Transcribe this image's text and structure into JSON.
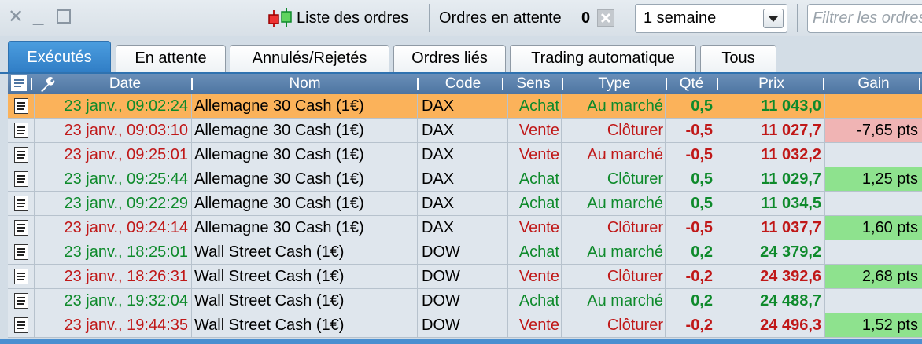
{
  "toolbar": {
    "close_icon": "close-icon",
    "minimize_icon": "minimize-icon",
    "maximize_icon": "maximize-icon",
    "title": "Liste des ordres",
    "pending_label": "Ordres en attente",
    "pending_count": "0",
    "period": "1 semaine",
    "filter_placeholder": "Filtrer les ordres"
  },
  "tabs": [
    "Exécutés",
    "En attente",
    "Annulés/Rejetés",
    "Ordres liés",
    "Trading automatique",
    "Tous"
  ],
  "columns": [
    "Date",
    "Nom",
    "Code",
    "Sens",
    "Type",
    "Qté",
    "Prix",
    "Gain"
  ],
  "colors": {
    "buy": "#0e8a2b",
    "sell": "#c01818",
    "selected": "#fbb25a",
    "gain_positive": "#8ee28e",
    "gain_negative": "#f0b4b4",
    "tab_active": "#3b8bd4"
  },
  "rows": [
    {
      "date": "23 janv., 09:02:24",
      "nom": "Allemagne 30 Cash (1€)",
      "code": "DAX",
      "sens": "Achat",
      "type": "Au marché",
      "qty": "0,5",
      "prix": "11 043,0",
      "gain": ""
    },
    {
      "date": "23 janv., 09:03:10",
      "nom": "Allemagne 30 Cash (1€)",
      "code": "DAX",
      "sens": "Vente",
      "type": "Clôturer",
      "qty": "-0,5",
      "prix": "11 027,7",
      "gain": "-7,65 pts"
    },
    {
      "date": "23 janv., 09:25:01",
      "nom": "Allemagne 30 Cash (1€)",
      "code": "DAX",
      "sens": "Vente",
      "type": "Au marché",
      "qty": "-0,5",
      "prix": "11 032,2",
      "gain": ""
    },
    {
      "date": "23 janv., 09:25:44",
      "nom": "Allemagne 30 Cash (1€)",
      "code": "DAX",
      "sens": "Achat",
      "type": "Clôturer",
      "qty": "0,5",
      "prix": "11 029,7",
      "gain": "1,25 pts"
    },
    {
      "date": "23 janv., 09:22:29",
      "nom": "Allemagne 30 Cash (1€)",
      "code": "DAX",
      "sens": "Achat",
      "type": "Au marché",
      "qty": "0,5",
      "prix": "11 034,5",
      "gain": ""
    },
    {
      "date": "23 janv., 09:24:14",
      "nom": "Allemagne 30 Cash (1€)",
      "code": "DAX",
      "sens": "Vente",
      "type": "Clôturer",
      "qty": "-0,5",
      "prix": "11 037,7",
      "gain": "1,60 pts"
    },
    {
      "date": "23 janv., 18:25:01",
      "nom": "Wall Street Cash (1€)",
      "code": "DOW",
      "sens": "Achat",
      "type": "Au marché",
      "qty": "0,2",
      "prix": "24 379,2",
      "gain": ""
    },
    {
      "date": "23 janv., 18:26:31",
      "nom": "Wall Street Cash (1€)",
      "code": "DOW",
      "sens": "Vente",
      "type": "Clôturer",
      "qty": "-0,2",
      "prix": "24 392,6",
      "gain": "2,68 pts"
    },
    {
      "date": "23 janv., 19:32:04",
      "nom": "Wall Street Cash (1€)",
      "code": "DOW",
      "sens": "Achat",
      "type": "Au marché",
      "qty": "0,2",
      "prix": "24 488,7",
      "gain": ""
    },
    {
      "date": "23 janv., 19:44:35",
      "nom": "Wall Street Cash (1€)",
      "code": "DOW",
      "sens": "Vente",
      "type": "Clôturer",
      "qty": "-0,2",
      "prix": "24 496,3",
      "gain": "1,52 pts"
    }
  ]
}
